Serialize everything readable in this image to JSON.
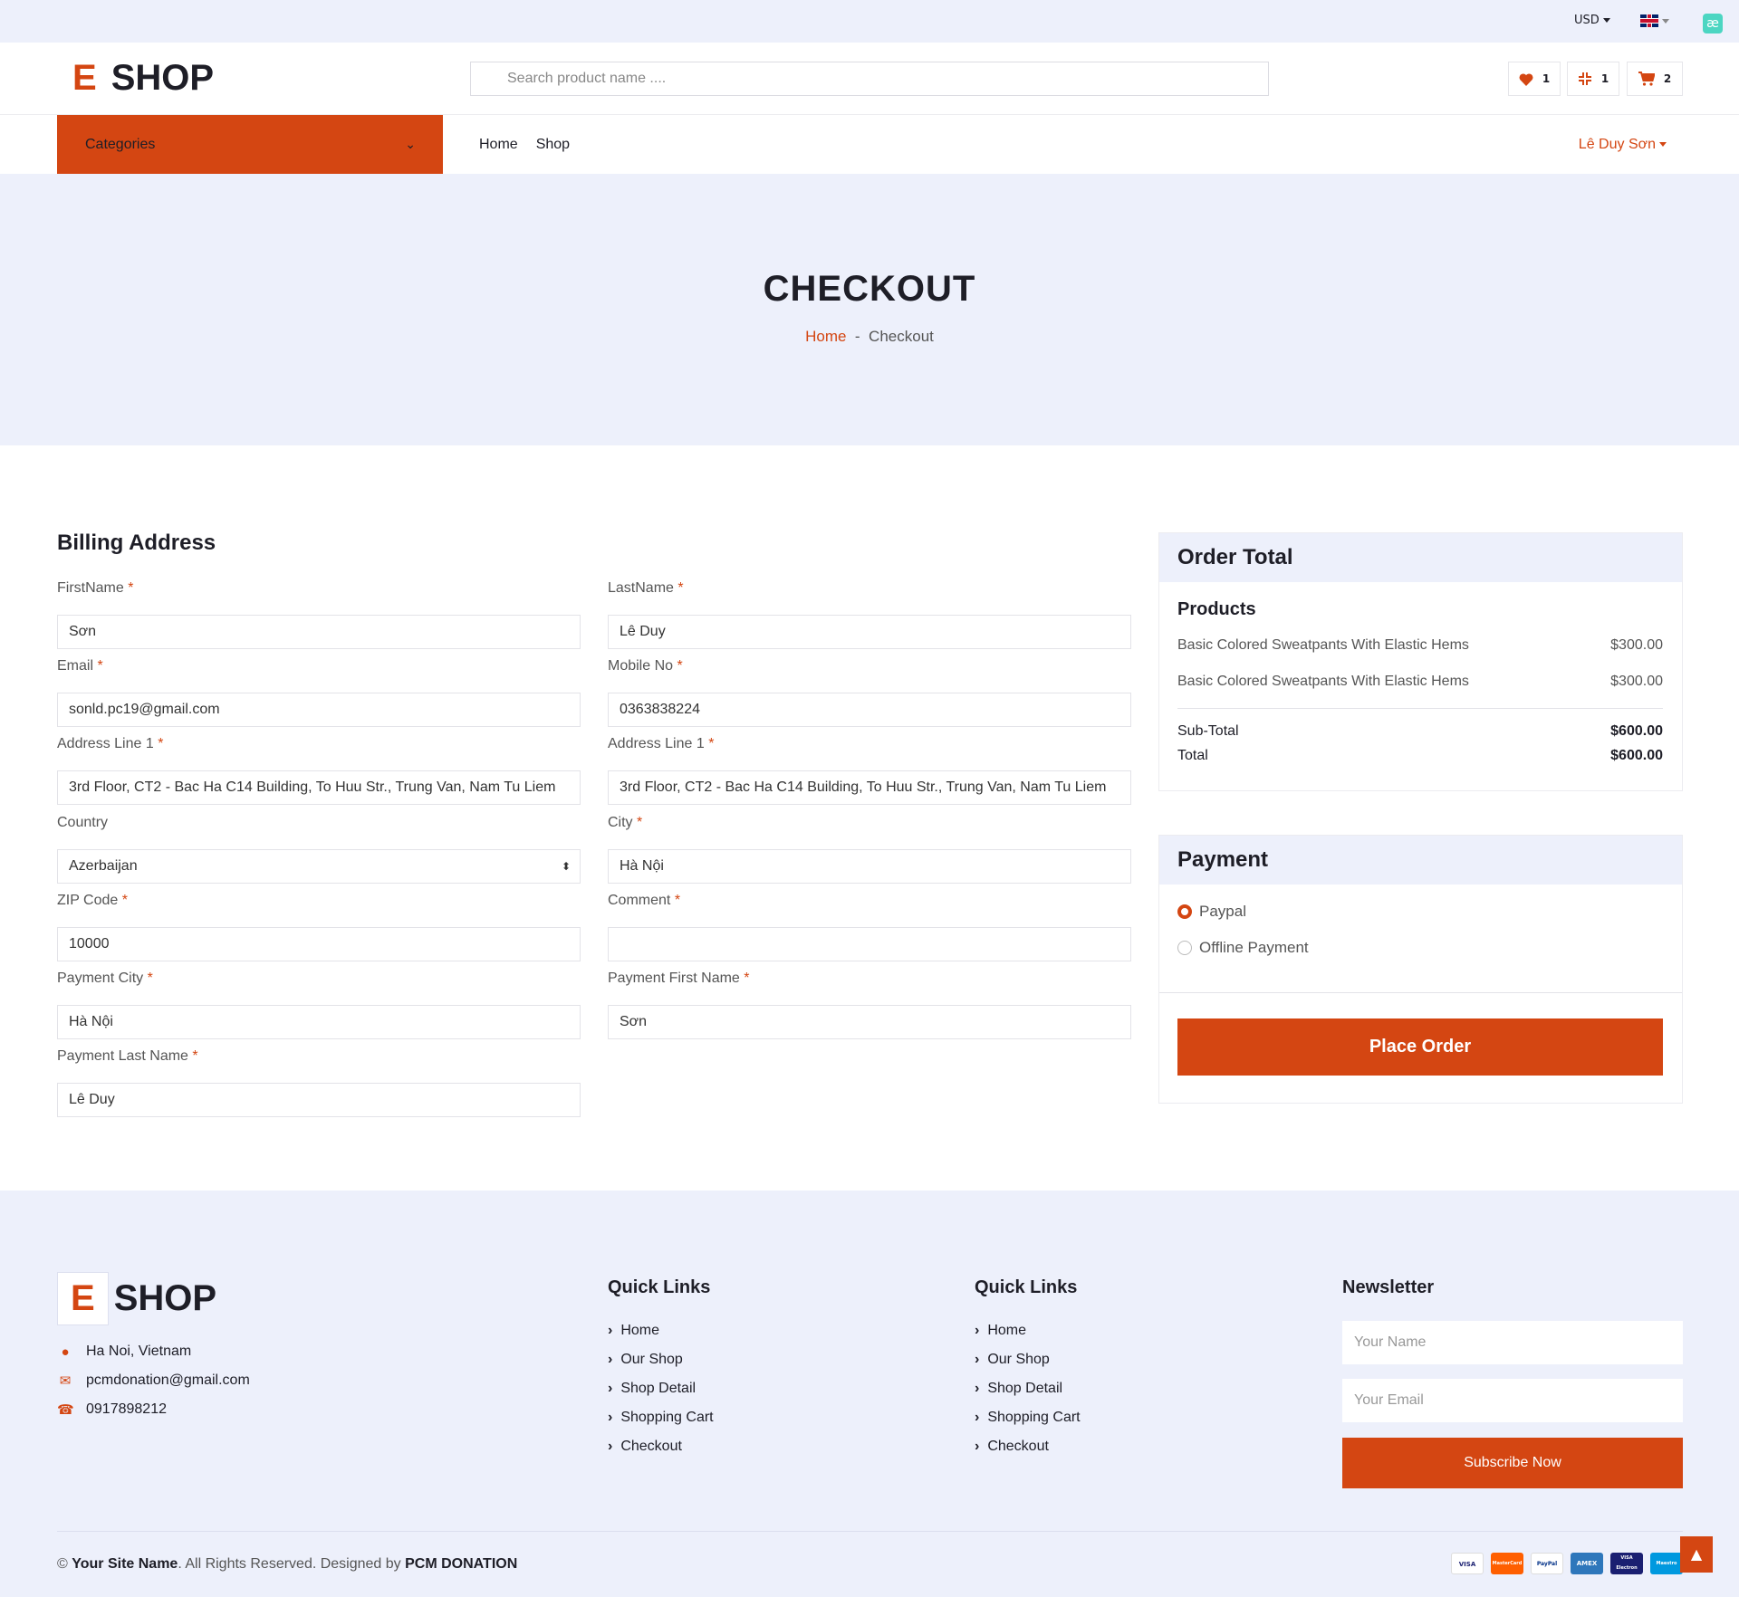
{
  "topbar": {
    "currency": "USD",
    "language_flag": "uk-flag",
    "extension_icon": "æ"
  },
  "brand": {
    "letter": "E",
    "name": "SHOP"
  },
  "header": {
    "search_placeholder": "Search product name ....",
    "wishlist_count": "1",
    "compare_count": "1",
    "cart_count": "2"
  },
  "nav": {
    "categories_label": "Categories",
    "links": [
      "Home",
      "Shop"
    ],
    "user_name": "Lê Duy Sơn"
  },
  "hero": {
    "title": "CHECKOUT",
    "breadcrumb_home": "Home",
    "breadcrumb_sep": "-",
    "breadcrumb_current": "Checkout"
  },
  "billing": {
    "title": "Billing Address",
    "required_mark": "*",
    "fields": {
      "first_name": {
        "label": "FirstName",
        "value": "Sơn"
      },
      "last_name": {
        "label": "LastName",
        "value": "Lê Duy"
      },
      "email": {
        "label": "Email",
        "value": "sonld.pc19@gmail.com"
      },
      "mobile": {
        "label": "Mobile No",
        "value": "0363838224"
      },
      "address1": {
        "label": "Address Line 1",
        "value": "3rd Floor, CT2 - Bac Ha C14 Building, To Huu Str., Trung Van, Nam Tu Liem"
      },
      "address2": {
        "label": "Address Line 1",
        "value": "3rd Floor, CT2 - Bac Ha C14 Building, To Huu Str., Trung Van, Nam Tu Liem"
      },
      "country": {
        "label": "Country",
        "value": "Azerbaijan"
      },
      "city": {
        "label": "City",
        "value": "Hà Nội"
      },
      "zip": {
        "label": "ZIP Code",
        "value": "10000"
      },
      "comment": {
        "label": "Comment",
        "value": ""
      },
      "payment_city": {
        "label": "Payment City",
        "value": "Hà Nội"
      },
      "payment_first_name": {
        "label": "Payment First Name",
        "value": "Sơn"
      },
      "payment_last_name": {
        "label": "Payment Last Name",
        "value": "Lê Duy"
      }
    }
  },
  "order": {
    "title": "Order Total",
    "products_title": "Products",
    "items": [
      {
        "name": "Basic Colored Sweatpants With Elastic Hems",
        "price": "$300.00"
      },
      {
        "name": "Basic Colored Sweatpants With Elastic Hems",
        "price": "$300.00"
      }
    ],
    "subtotal_label": "Sub-Total",
    "subtotal": "$600.00",
    "total_label": "Total",
    "total": "$600.00"
  },
  "payment": {
    "title": "Payment",
    "options": [
      {
        "label": "Paypal",
        "selected": true
      },
      {
        "label": "Offline Payment",
        "selected": false
      }
    ],
    "place_order": "Place Order"
  },
  "footer": {
    "location": "Ha Noi, Vietnam",
    "email": "pcmdonation@gmail.com",
    "phone": "0917898212",
    "quick_links_1": {
      "title": "Quick Links",
      "items": [
        "Home",
        "Our Shop",
        "Shop Detail",
        "Shopping Cart",
        "Checkout"
      ]
    },
    "quick_links_2": {
      "title": "Quick Links",
      "items": [
        "Home",
        "Our Shop",
        "Shop Detail",
        "Shopping Cart",
        "Checkout"
      ]
    },
    "newsletter": {
      "title": "Newsletter",
      "name_placeholder": "Your Name",
      "email_placeholder": "Your Email",
      "button": "Subscribe Now"
    },
    "copyright_symbol": "©",
    "site_name": "Your Site Name",
    "rights_text": ". All Rights Reserved. Designed by ",
    "designer": "PCM DONATION",
    "payment_cards": [
      "VISA",
      "MasterCard",
      "PayPal",
      "AMEX",
      "VISA Electron",
      "Maestro"
    ]
  },
  "colors": {
    "accent": "#d44612",
    "light_bg": "#edf0fb",
    "text": "#1e1e27"
  }
}
